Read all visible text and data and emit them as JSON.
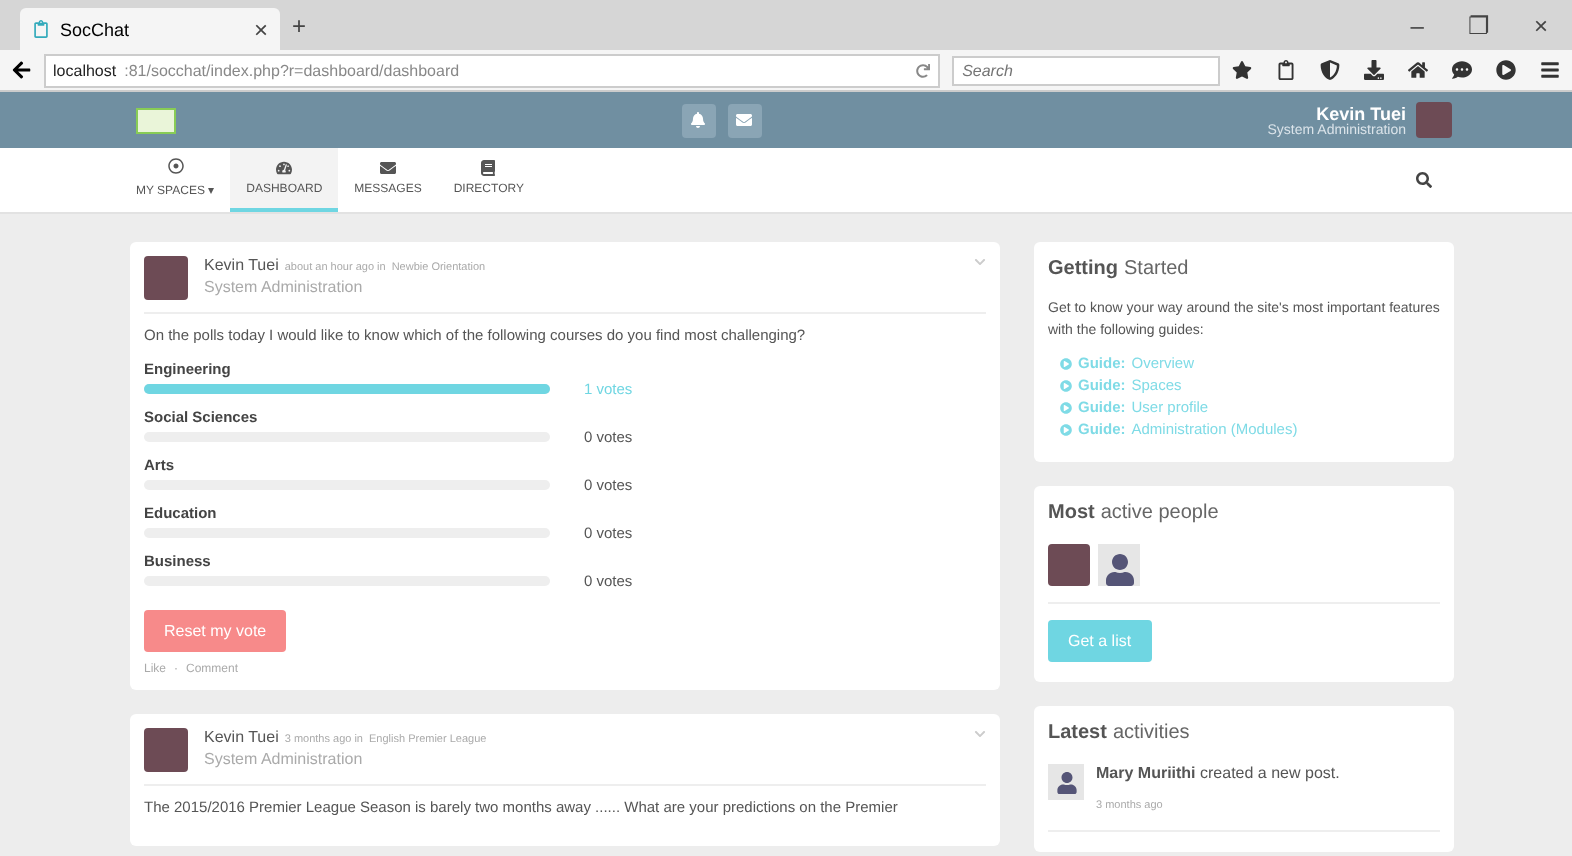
{
  "browser": {
    "tab_title": "SocChat",
    "tab_close": "×",
    "new_tab": "+",
    "url_host": "localhost",
    "url_rest": ":81/socchat/index.php?r=dashboard/dashboard",
    "search_placeholder": "Search",
    "window_controls": [
      "–",
      "❐",
      "×"
    ]
  },
  "topbar": {
    "user_name": "Kevin Tuei",
    "user_role": "System Administration"
  },
  "nav": [
    {
      "label": "MY SPACES",
      "caret": "▾",
      "selected": false
    },
    {
      "label": "DASHBOARD",
      "selected": true
    },
    {
      "label": "MESSAGES",
      "selected": false
    },
    {
      "label": "DIRECTORY",
      "selected": false
    }
  ],
  "posts": [
    {
      "author": "Kevin Tuei",
      "meta": "about an hour ago in",
      "space": "Newbie Orientation",
      "role": "System Administration",
      "text": "On the polls today I would like to know which of the following courses do you find most challenging?",
      "poll": [
        {
          "option": "Engineering",
          "level": 1,
          "votes": "1 votes"
        },
        {
          "option": "Social Sciences",
          "level": 0,
          "votes": "0 votes"
        },
        {
          "option": "Arts",
          "level": 0,
          "votes": "0 votes"
        },
        {
          "option": "Education",
          "level": 0,
          "votes": "0 votes"
        },
        {
          "option": "Business",
          "level": 0,
          "votes": "0 votes"
        }
      ],
      "button": "Reset my vote",
      "actions": [
        "Like",
        "Comment"
      ],
      "action_separator": "·"
    },
    {
      "author": "Kevin Tuei",
      "meta": "3 months ago in",
      "space": "English Premier League",
      "role": "System Administration",
      "text": "The 2015/2016 Premier League Season is barely two months away ...... What are your predictions on the Premier"
    }
  ],
  "getting_started": {
    "title_bold": "Getting",
    "title_rest": "Started",
    "text": "Get to know your way around the site's most important features with the following guides:",
    "guides": [
      {
        "label": "Guide:",
        "target": "Overview"
      },
      {
        "label": "Guide:",
        "target": "Spaces"
      },
      {
        "label": "Guide:",
        "target": "User profile"
      },
      {
        "label": "Guide:",
        "target": "Administration (Modules)"
      }
    ]
  },
  "active_people": {
    "title_bold": "Most",
    "title_rest": "active people",
    "people": [
      {
        "kind": "photo"
      },
      {
        "kind": "silhouette"
      }
    ],
    "button": "Get a list"
  },
  "activities": {
    "title_bold": "Latest",
    "title_rest": "activities",
    "items": [
      {
        "name": "Mary Muriithi",
        "action": "created a new post.",
        "time": "3 months ago"
      }
    ]
  }
}
